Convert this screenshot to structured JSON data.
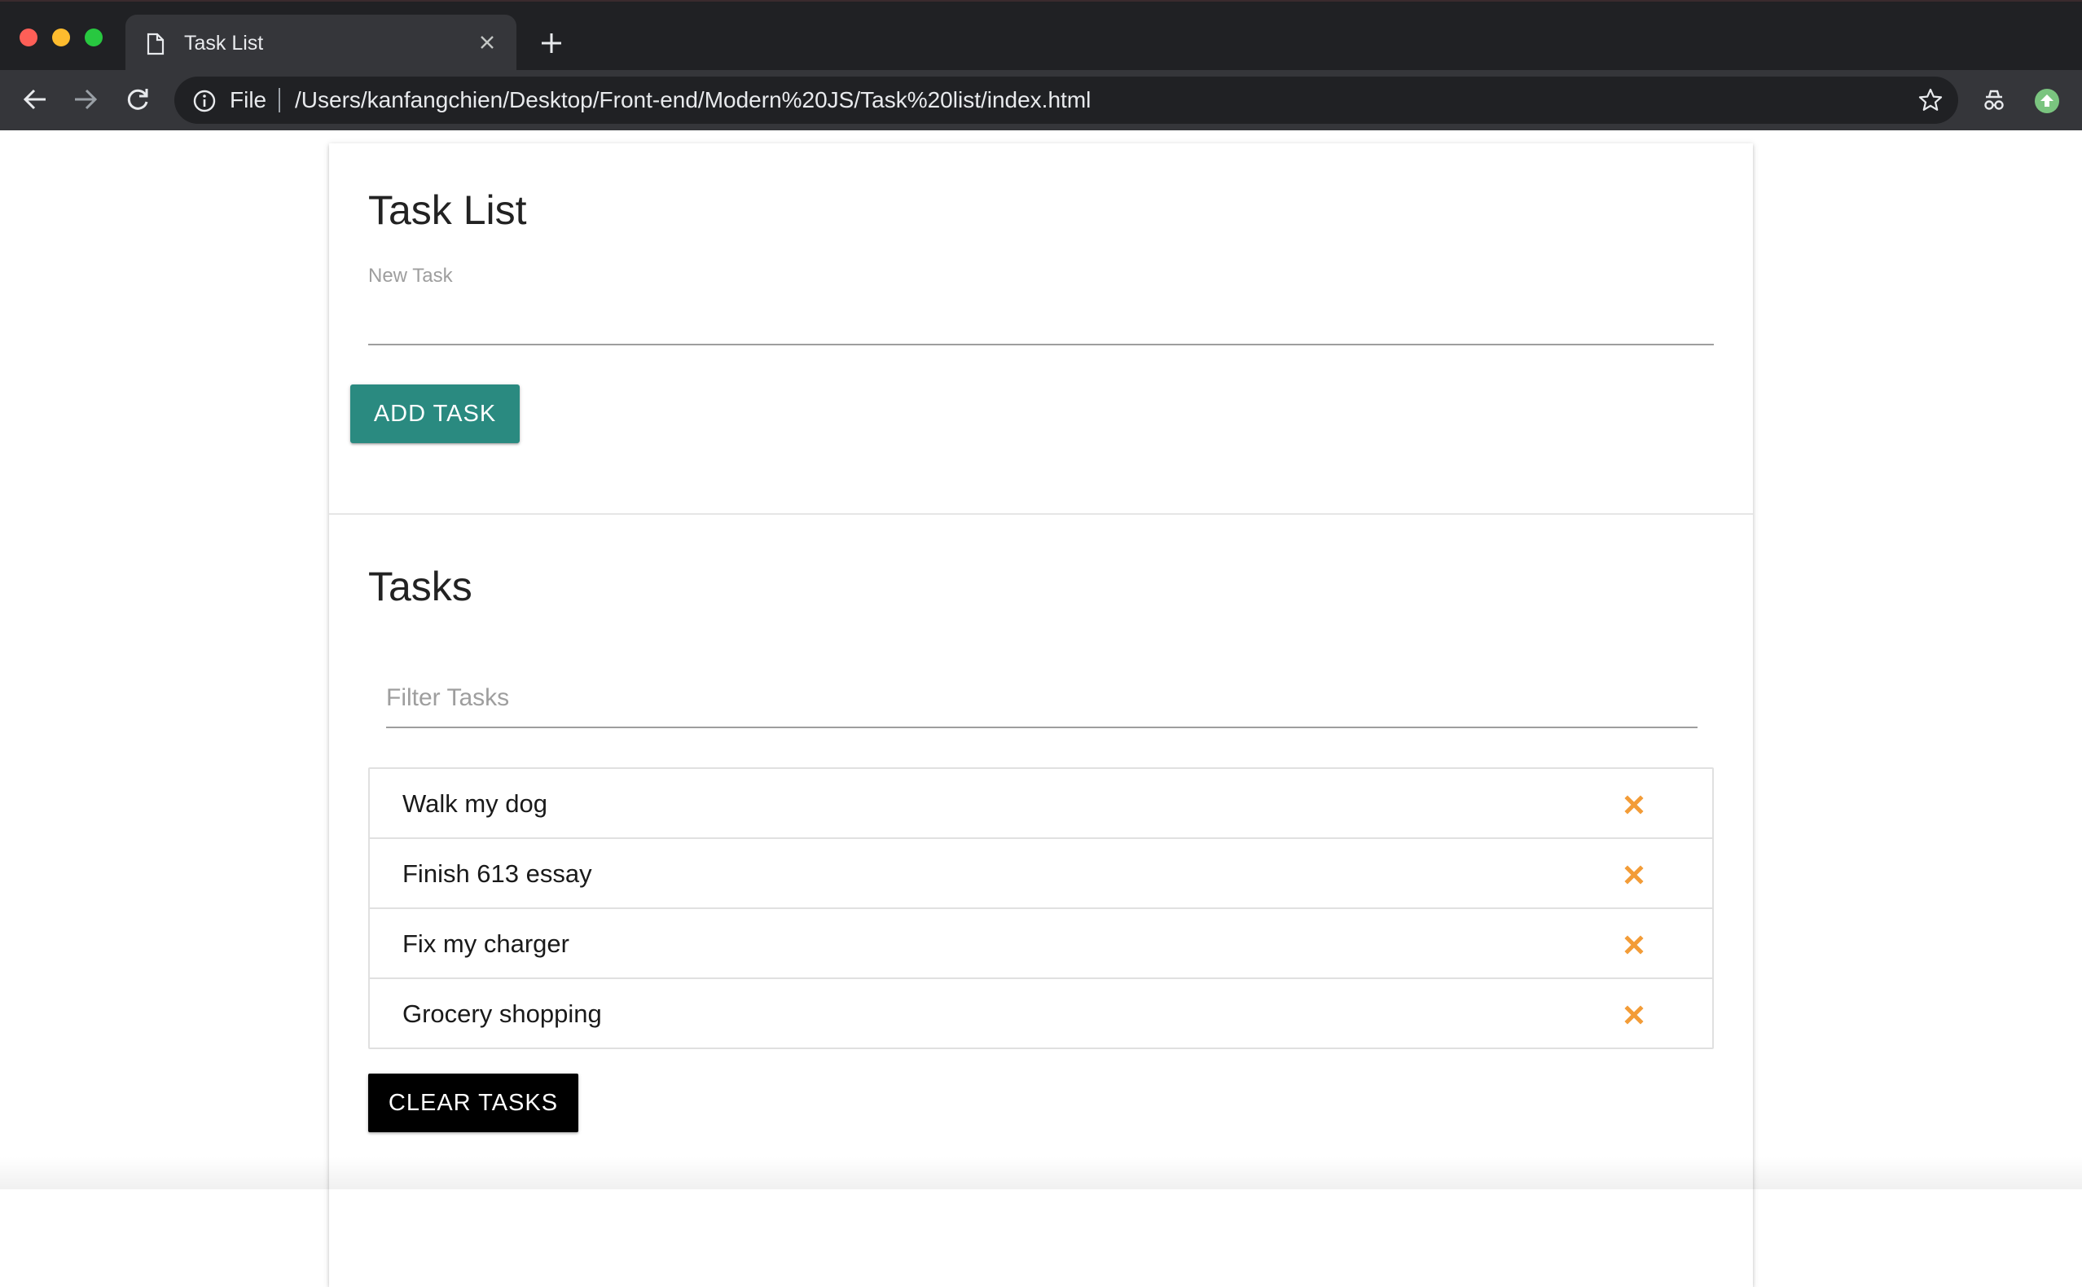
{
  "browser": {
    "tab_title": "Task List",
    "url_scheme": "File",
    "url": "/Users/kanfangchien/Desktop/Front-end/Modern%20JS/Task%20list/index.html"
  },
  "form": {
    "title": "Task List",
    "new_task_label": "New Task",
    "new_task_value": "",
    "add_button": "ADD TASK"
  },
  "tasks": {
    "title": "Tasks",
    "filter_placeholder": "Filter Tasks",
    "filter_value": "",
    "items": [
      {
        "text": "Walk my dog"
      },
      {
        "text": "Finish 613 essay"
      },
      {
        "text": "Fix my charger"
      },
      {
        "text": "Grocery shopping"
      }
    ],
    "clear_button": "CLEAR TASKS"
  },
  "colors": {
    "add_button": "#2a8a80",
    "delete_icon": "#f39c37",
    "clear_button": "#000000"
  },
  "icons": {
    "delete": "times-icon"
  }
}
